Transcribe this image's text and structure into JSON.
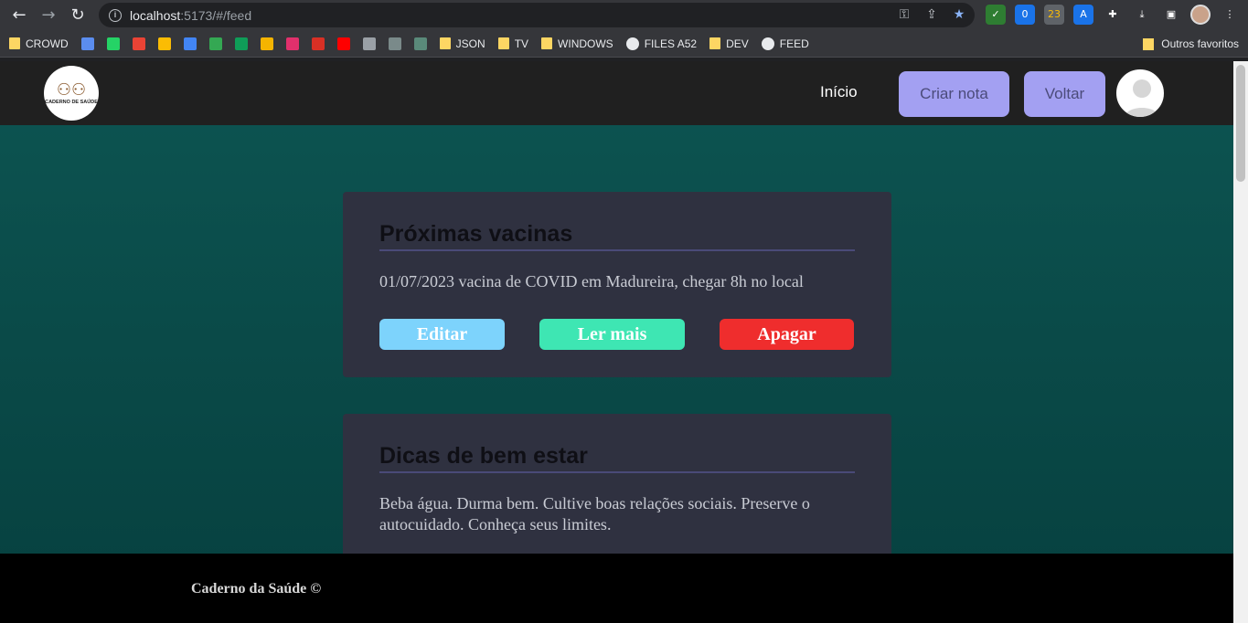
{
  "browser": {
    "url_host": "localhost",
    "url_path": ":5173/#/feed",
    "ext_badge_1": "0",
    "ext_badge_2": "23",
    "bookmarks": [
      {
        "label": "CROWD",
        "icon": "folder"
      },
      {
        "label": "",
        "icon": "app-icon",
        "color": "#5b8def"
      },
      {
        "label": "",
        "icon": "whatsapp-icon",
        "color": "#25d366"
      },
      {
        "label": "",
        "icon": "gmail-icon",
        "color": "#ea4335"
      },
      {
        "label": "",
        "icon": "drive-icon",
        "color": "#fbbc04"
      },
      {
        "label": "",
        "icon": "translate-icon",
        "color": "#4285f4"
      },
      {
        "label": "",
        "icon": "maps-icon",
        "color": "#34a853"
      },
      {
        "label": "",
        "icon": "sheets-icon",
        "color": "#0f9d58"
      },
      {
        "label": "",
        "icon": "app-icon",
        "color": "#f4b400"
      },
      {
        "label": "",
        "icon": "instagram-icon",
        "color": "#e1306c"
      },
      {
        "label": "",
        "icon": "app-icon",
        "color": "#d93025"
      },
      {
        "label": "",
        "icon": "youtube-icon",
        "color": "#ff0000"
      },
      {
        "label": "",
        "icon": "app-icon",
        "color": "#9aa0a6"
      },
      {
        "label": "",
        "icon": "terminal-icon",
        "color": "#7a8a8a"
      },
      {
        "label": "",
        "icon": "terminal-icon",
        "color": "#5a8a7a"
      },
      {
        "label": "JSON",
        "icon": "folder"
      },
      {
        "label": "TV",
        "icon": "folder"
      },
      {
        "label": "WINDOWS",
        "icon": "folder"
      },
      {
        "label": "FILES A52",
        "icon": "globe"
      },
      {
        "label": "DEV",
        "icon": "folder"
      },
      {
        "label": "FEED",
        "icon": "globe"
      }
    ],
    "other_bookmarks": "Outros favoritos"
  },
  "header": {
    "logo_text": "CADERNO DE SAÚDE",
    "nav_home": "Início",
    "create_note": "Criar nota",
    "back": "Voltar"
  },
  "cards": [
    {
      "title": "Próximas vacinas",
      "text": "01/07/2023 vacina de COVID em Madureira, chegar 8h no local",
      "edit": "Editar",
      "read_more": "Ler mais",
      "delete": "Apagar"
    },
    {
      "title": "Dicas de bem estar",
      "text": "Beba água. Durma bem. Cultive boas relações sociais. Preserve o autocuidado. Conheça seus limites."
    }
  ],
  "footer": {
    "text": "Caderno da Saúde ©"
  },
  "colors": {
    "accent": "#a3a0f2",
    "edit": "#7dd3fc",
    "read_more": "#3ee6b3",
    "delete": "#ef2d2d",
    "background": "#0a4a48"
  }
}
